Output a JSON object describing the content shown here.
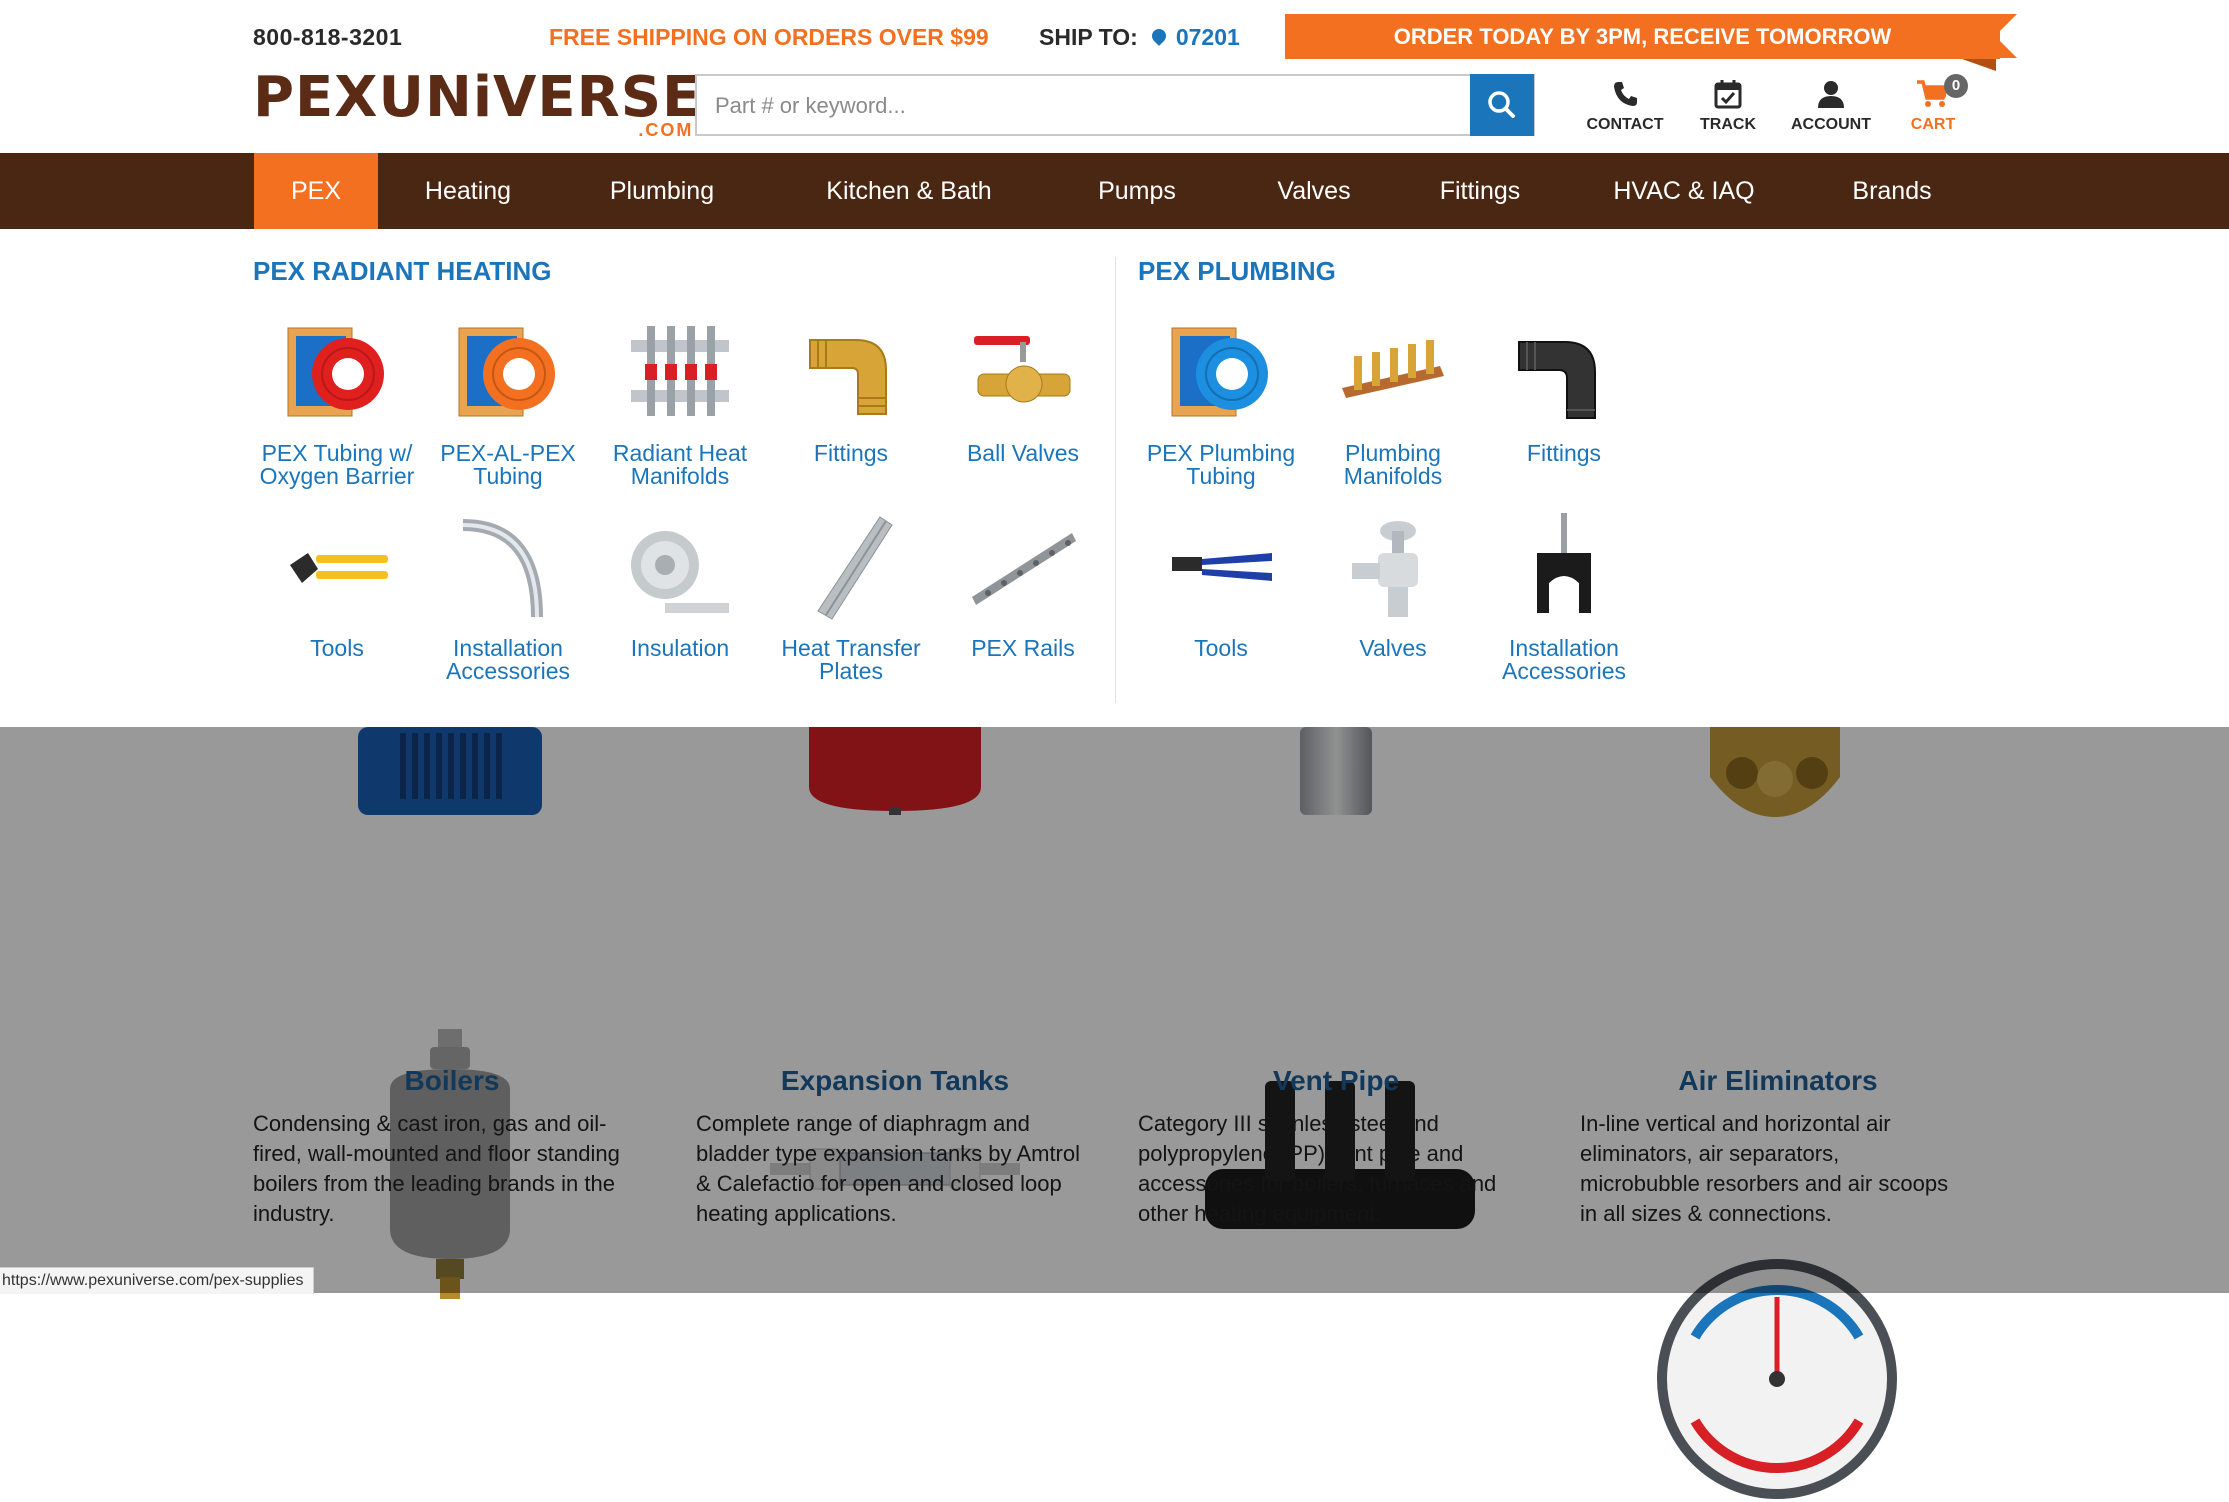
{
  "header": {
    "phone": "800-818-3201",
    "shipping_promo": "FREE SHIPPING ON ORDERS OVER $99",
    "ship_to_label": "SHIP TO:",
    "ship_to_zip": "07201",
    "order_banner": "ORDER TODAY BY 3PM, RECEIVE TOMORROW",
    "logo_text": "PEXUNiVERSE",
    "logo_suffix": ".COM",
    "search_placeholder": "Part # or keyword...",
    "utilities": {
      "contact": "CONTACT",
      "track": "TRACK",
      "account": "ACCOUNT",
      "cart": "CART",
      "cart_count": "0"
    }
  },
  "nav": {
    "items": [
      "PEX",
      "Heating",
      "Plumbing",
      "Kitchen & Bath",
      "Pumps",
      "Valves",
      "Fittings",
      "HVAC & IAQ",
      "Brands"
    ],
    "active": "PEX"
  },
  "mega_menu": {
    "radiant": {
      "title": "PEX RADIANT HEATING",
      "items": [
        {
          "l1": "PEX Tubing w/",
          "l2": "Oxygen Barrier",
          "icon": "red-pex-coil-icon"
        },
        {
          "l1": "PEX-AL-PEX",
          "l2": "Tubing",
          "icon": "orange-pex-coil-icon"
        },
        {
          "l1": "Radiant Heat",
          "l2": "Manifolds",
          "icon": "manifold-icon"
        },
        {
          "l1": "Fittings",
          "l2": "",
          "icon": "brass-elbow-icon"
        },
        {
          "l1": "Ball Valves",
          "l2": "",
          "icon": "ball-valve-icon"
        },
        {
          "l1": "Tools",
          "l2": "",
          "icon": "crimp-tool-icon"
        },
        {
          "l1": "Installation",
          "l2": "Accessories",
          "icon": "bend-support-icon"
        },
        {
          "l1": "Insulation",
          "l2": "",
          "icon": "insulation-roll-icon"
        },
        {
          "l1": "Heat Transfer",
          "l2": "Plates",
          "icon": "heat-plate-icon"
        },
        {
          "l1": "PEX Rails",
          "l2": "",
          "icon": "pex-rail-icon"
        }
      ]
    },
    "plumbing": {
      "title": "PEX PLUMBING",
      "items": [
        {
          "l1": "PEX Plumbing",
          "l2": "Tubing",
          "icon": "blue-pex-coil-icon"
        },
        {
          "l1": "Plumbing",
          "l2": "Manifolds",
          "icon": "copper-manifold-icon"
        },
        {
          "l1": "Fittings",
          "l2": "",
          "icon": "poly-elbow-icon"
        },
        {
          "l1": "Tools",
          "l2": "",
          "icon": "cinch-tool-icon"
        },
        {
          "l1": "Valves",
          "l2": "",
          "icon": "stop-valve-icon"
        },
        {
          "l1": "Installation",
          "l2": "Accessories",
          "icon": "pipe-clip-icon"
        }
      ]
    }
  },
  "categories": [
    {
      "title": "Boilers",
      "desc": "Condensing & cast iron, gas and oil-fired, wall-mounted and floor standing boilers from the leading brands in the industry."
    },
    {
      "title": "Expansion Tanks",
      "desc": "Complete range of diaphragm and bladder type expansion tanks by Amtrol & Calefactio for open and closed loop heating applications."
    },
    {
      "title": "Vent Pipe",
      "desc": "Category III stainless steel and polypropylene (PP) vent pipe and accessories for boilers, furnaces and other heating equipment."
    },
    {
      "title": "Air Eliminators",
      "desc": "In-line vertical and horizontal air eliminators, air separators, microbubble resorbers and air scoops in all sizes & connections."
    }
  ],
  "status_url": "https://www.pexuniverse.com/pex-supplies"
}
